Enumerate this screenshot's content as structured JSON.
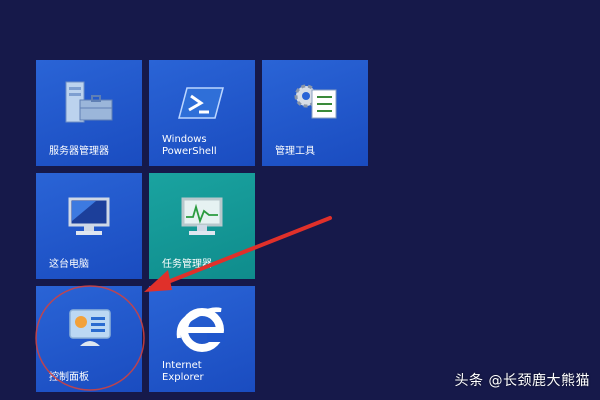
{
  "colors": {
    "background": "#16194a",
    "tile_blue": "#1f56cc",
    "tile_teal": "#12999a",
    "annotation_red": "#e0302a"
  },
  "tiles": [
    {
      "label": "服务器管理器",
      "icon": "server-manager-icon"
    },
    {
      "label": "Windows\nPowerShell",
      "icon": "powershell-icon"
    },
    {
      "label": "管理工具",
      "icon": "admin-tools-icon"
    },
    {
      "label": "这台电脑",
      "icon": "this-pc-icon"
    },
    {
      "label": "任务管理器",
      "icon": "task-manager-icon"
    },
    {
      "label": "控制面板",
      "icon": "control-panel-icon"
    },
    {
      "label": "Internet\nExplorer",
      "icon": "internet-explorer-icon"
    }
  ],
  "watermark": "头条 @长颈鹿大熊猫"
}
